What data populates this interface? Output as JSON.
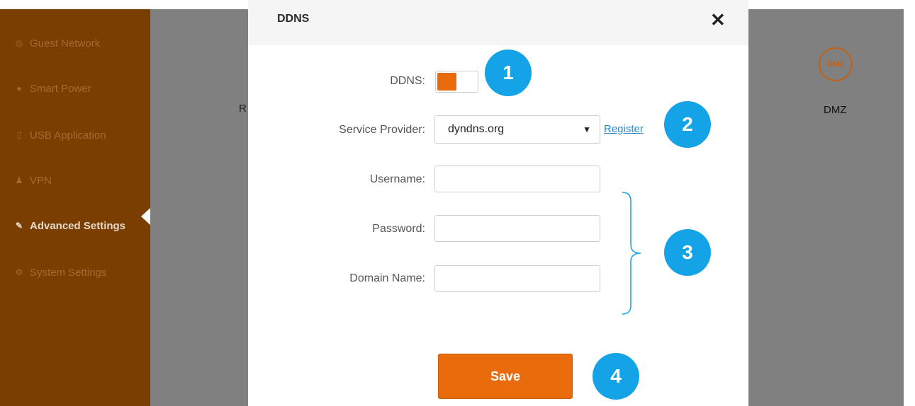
{
  "sidebar": {
    "items": [
      {
        "label": "Guest Network",
        "icon": "wifi-icon"
      },
      {
        "label": "Smart Power",
        "icon": "bulb-icon"
      },
      {
        "label": "USB Application",
        "icon": "usb-icon"
      },
      {
        "label": "VPN",
        "icon": "vpn-icon"
      },
      {
        "label": "Advanced Settings",
        "icon": "wrench-icon",
        "active": true
      },
      {
        "label": "System Settings",
        "icon": "gear-icon"
      }
    ]
  },
  "background": {
    "partial_text": "R",
    "dmz_icon_text": "DMZ",
    "dmz_label": "DMZ"
  },
  "modal": {
    "title": "DDNS",
    "close_glyph": "✕",
    "ddns_label": "DDNS:",
    "ddns_enabled": true,
    "provider_label": "Service Provider:",
    "provider_value": "dyndns.org",
    "register_label": "Register",
    "username_label": "Username:",
    "username_value": "",
    "password_label": "Password:",
    "password_value": "",
    "domain_label": "Domain Name:",
    "domain_value": "",
    "save_label": "Save"
  },
  "annotations": {
    "badges": [
      "1",
      "2",
      "3",
      "4"
    ],
    "badge_color": "#14a3e6"
  },
  "colors": {
    "accent": "#ea6b0c",
    "sidebar_bg": "#7a3e00",
    "link": "#2a86c8"
  }
}
